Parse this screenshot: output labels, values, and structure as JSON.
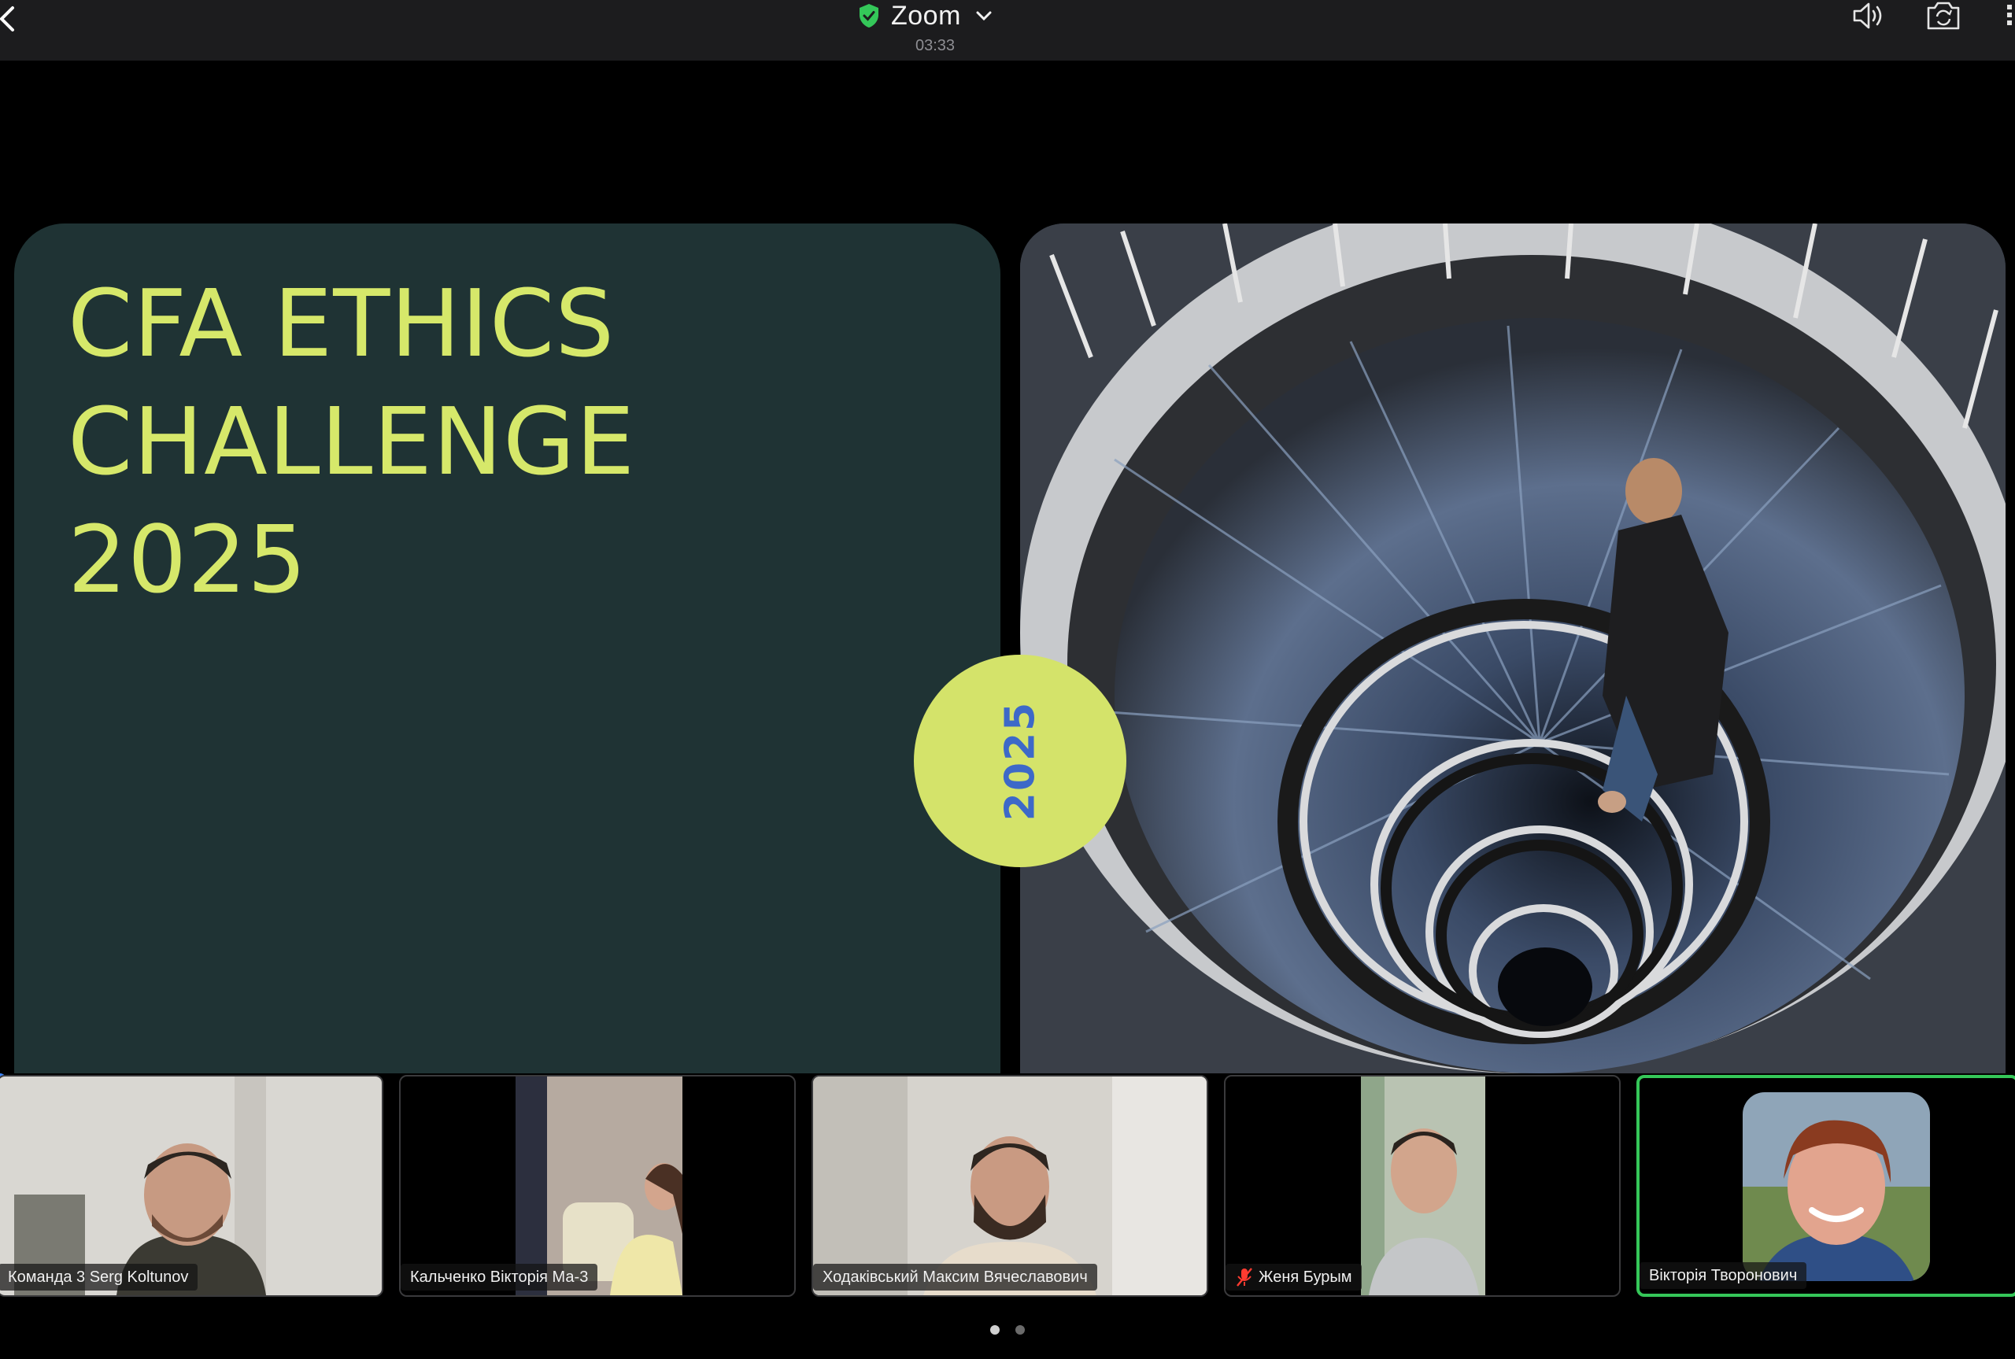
{
  "topbar": {
    "title": "Zoom",
    "timer": "03:33",
    "icons": [
      "back-icon",
      "shield-check-icon",
      "chevron-down-icon",
      "speaker-icon",
      "camera-switch-icon",
      "grid-icon"
    ],
    "shield_color": "#34c759"
  },
  "slide": {
    "title_lines": [
      "CFA ETHICS",
      "CHALLENGE",
      "2025"
    ],
    "badge_text": "2025",
    "colors": {
      "panel": "#1f3334",
      "title": "#d6e86a",
      "badge": "#d4e36a",
      "badge_text": "#3d69c8"
    }
  },
  "participants": [
    {
      "name": "Команда 3 Serg Koltunov",
      "muted": false,
      "active": false
    },
    {
      "name": "Кальченко Вікторія Ма-3",
      "muted": false,
      "active": false
    },
    {
      "name": "Ходаківський Максим Вячеславович",
      "muted": false,
      "active": false
    },
    {
      "name": "Женя Бурым",
      "muted": true,
      "active": false
    },
    {
      "name": "Вікторія Творонович",
      "muted": false,
      "active": true
    }
  ],
  "pager": {
    "pages": 2,
    "current": 1
  }
}
